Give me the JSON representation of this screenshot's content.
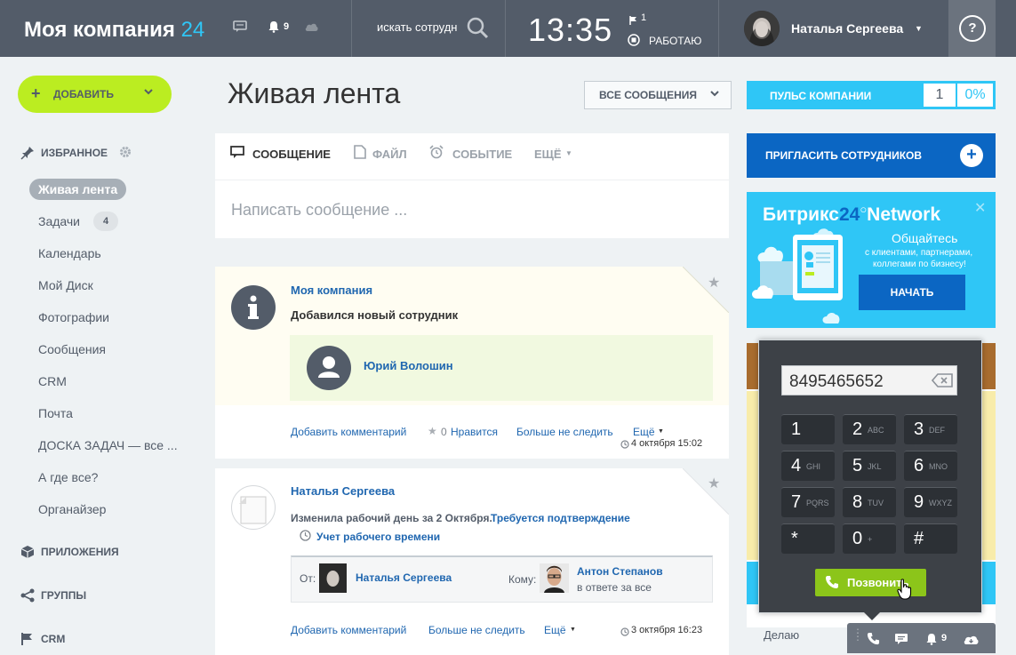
{
  "topbar": {
    "logo_text": "Моя компания",
    "logo_num": "24",
    "notif_count": "9",
    "search_placeholder": "искать сотрудника",
    "clock": "13:35",
    "flag_count": "1",
    "work_status": "РАБОТАЮ",
    "user_name": "Наталья Сергеева",
    "help": "?"
  },
  "sidebar": {
    "add_label": "ДОБАВИТЬ",
    "favorites": "ИЗБРАННОЕ",
    "items": [
      {
        "label": "Живая лента"
      },
      {
        "label": "Задачи",
        "badge": "4"
      },
      {
        "label": "Календарь"
      },
      {
        "label": "Мой Диск"
      },
      {
        "label": "Фотографии"
      },
      {
        "label": "Сообщения"
      },
      {
        "label": "CRM"
      },
      {
        "label": "Почта"
      },
      {
        "label": "ДОСКА ЗАДАЧ — все ..."
      },
      {
        "label": "А где все?"
      },
      {
        "label": "Органайзер"
      }
    ],
    "apps": "ПРИЛОЖЕНИЯ",
    "groups": "ГРУППЫ",
    "crm": "CRM"
  },
  "main": {
    "title": "Живая лента",
    "filter": "ВСЕ СООБЩЕНИЯ",
    "tabs": [
      "СООБЩЕНИЕ",
      "ФАЙЛ",
      "СОБЫТИЕ",
      "ЕЩЁ"
    ],
    "compose_placeholder": "Написать сообщение ...",
    "posts": [
      {
        "author": "Моя компания",
        "text": "Добавился новый сотрудник",
        "employee": "Юрий Волошин",
        "actions": {
          "comment": "Добавить комментарий",
          "like_count": "0",
          "like": "Нравится",
          "unfollow": "Больше не следить",
          "more": "Ещё"
        },
        "date": "4 октября 15:02"
      },
      {
        "author": "Наталья Сергеева",
        "text": "Изменила рабочий день за 2 Октября.",
        "text_link": "Требуется подтверждение",
        "sub_link": "Учет рабочего времени",
        "from_label": "От:",
        "from_name": "Наталья Сергеева",
        "to_label": "Кому:",
        "to_name": "Антон Степанов",
        "to_role": "в ответе за все",
        "actions": {
          "comment": "Добавить комментарий",
          "unfollow": "Больше не следить",
          "more": "Ещё"
        },
        "date": "3 октября 16:23"
      }
    ]
  },
  "right": {
    "pulse_label": "ПУЛЬС КОМПАНИИ",
    "pulse_value": "1",
    "pulse_percent": "0%",
    "invite_label": "ПРИГЛАСИТЬ СОТРУДНИКОВ",
    "network_title_a": "Битрикс",
    "network_title_num": "24",
    "network_title_b": "Network",
    "network_subtitle": "Общайтесь",
    "network_desc1": "с клиентами, партнерами,",
    "network_desc2": "коллегами по бизнесу!",
    "network_button": "НАЧАТЬ",
    "bottom_text": "Делаю",
    "bottom_count": "9"
  },
  "dialer": {
    "number": "8495465652",
    "keys": [
      {
        "d": "1",
        "l": ""
      },
      {
        "d": "2",
        "l": "ABC"
      },
      {
        "d": "3",
        "l": "DEF"
      },
      {
        "d": "4",
        "l": "GHI"
      },
      {
        "d": "5",
        "l": "JKL"
      },
      {
        "d": "6",
        "l": "MNO"
      },
      {
        "d": "7",
        "l": "PQRS"
      },
      {
        "d": "8",
        "l": "TUV"
      },
      {
        "d": "9",
        "l": "WXYZ"
      },
      {
        "d": "*",
        "l": ""
      },
      {
        "d": "0",
        "l": "+"
      },
      {
        "d": "#",
        "l": ""
      }
    ],
    "call_label": "Позвонить"
  },
  "colors": {
    "topbar": "#535c69",
    "accent_blue": "#2fc6f6",
    "add_green": "#bbed21",
    "link": "#2067b0",
    "call_green": "#8cc51a"
  }
}
